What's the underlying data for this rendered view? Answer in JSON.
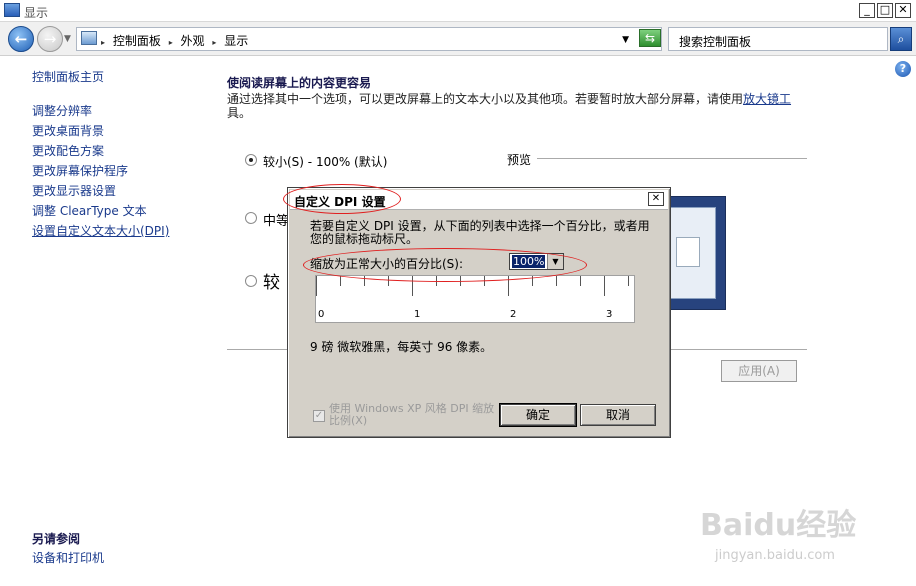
{
  "window": {
    "title": "显示"
  },
  "address": {
    "crumbs": [
      "控制面板",
      "外观",
      "显示"
    ],
    "search_placeholder": "搜索控制面板"
  },
  "sidebar": {
    "home": "控制面板主页",
    "items": [
      {
        "label": "调整分辨率"
      },
      {
        "label": "更改桌面背景"
      },
      {
        "label": "更改配色方案"
      },
      {
        "label": "更改屏幕保护程序"
      },
      {
        "label": "更改显示器设置"
      },
      {
        "label": "调整 ClearType 文本"
      },
      {
        "label": "设置自定义文本大小(DPI)"
      }
    ],
    "see_also_title": "另请参阅",
    "see_also_link": "设备和打印机"
  },
  "main": {
    "title": "使阅读屏幕上的内容更容易",
    "desc": "通过选择其中一个选项，可以更改屏幕上的文本大小以及其他项。若要暂时放大部分屏幕，请使用",
    "desc_link": "放大镜工",
    "desc_tail": "具。",
    "options": [
      {
        "label": "较小(S) - 100% (默认)",
        "selected": true
      },
      {
        "label": "中等",
        "selected": false
      },
      {
        "label": "较",
        "selected": false
      }
    ],
    "preview_label": "预览",
    "apply_label": "应用(A)"
  },
  "dialog": {
    "title": "自定义 DPI 设置",
    "instructions": "若要自定义 DPI 设置，从下面的列表中选择一个百分比，或者用您的鼠标拖动标尺。",
    "scale_label": "缩放为正常大小的百分比(S):",
    "scale_value": "100%",
    "ruler_labels": [
      "0",
      "1",
      "2",
      "3"
    ],
    "info": "9 磅 微软雅黑，每英寸 96 像素。",
    "checkbox_label": "使用 Windows XP 风格 DPI 缩放比例(X)",
    "checkbox_checked": true,
    "ok_label": "确定",
    "cancel_label": "取消"
  },
  "watermark": {
    "main": "Baidu经验",
    "sub": "jingyan.baidu.com"
  },
  "colors": {
    "link": "#1a3a8c",
    "annotation": "#e02020",
    "dialog_bg": "#d4d0c8"
  }
}
